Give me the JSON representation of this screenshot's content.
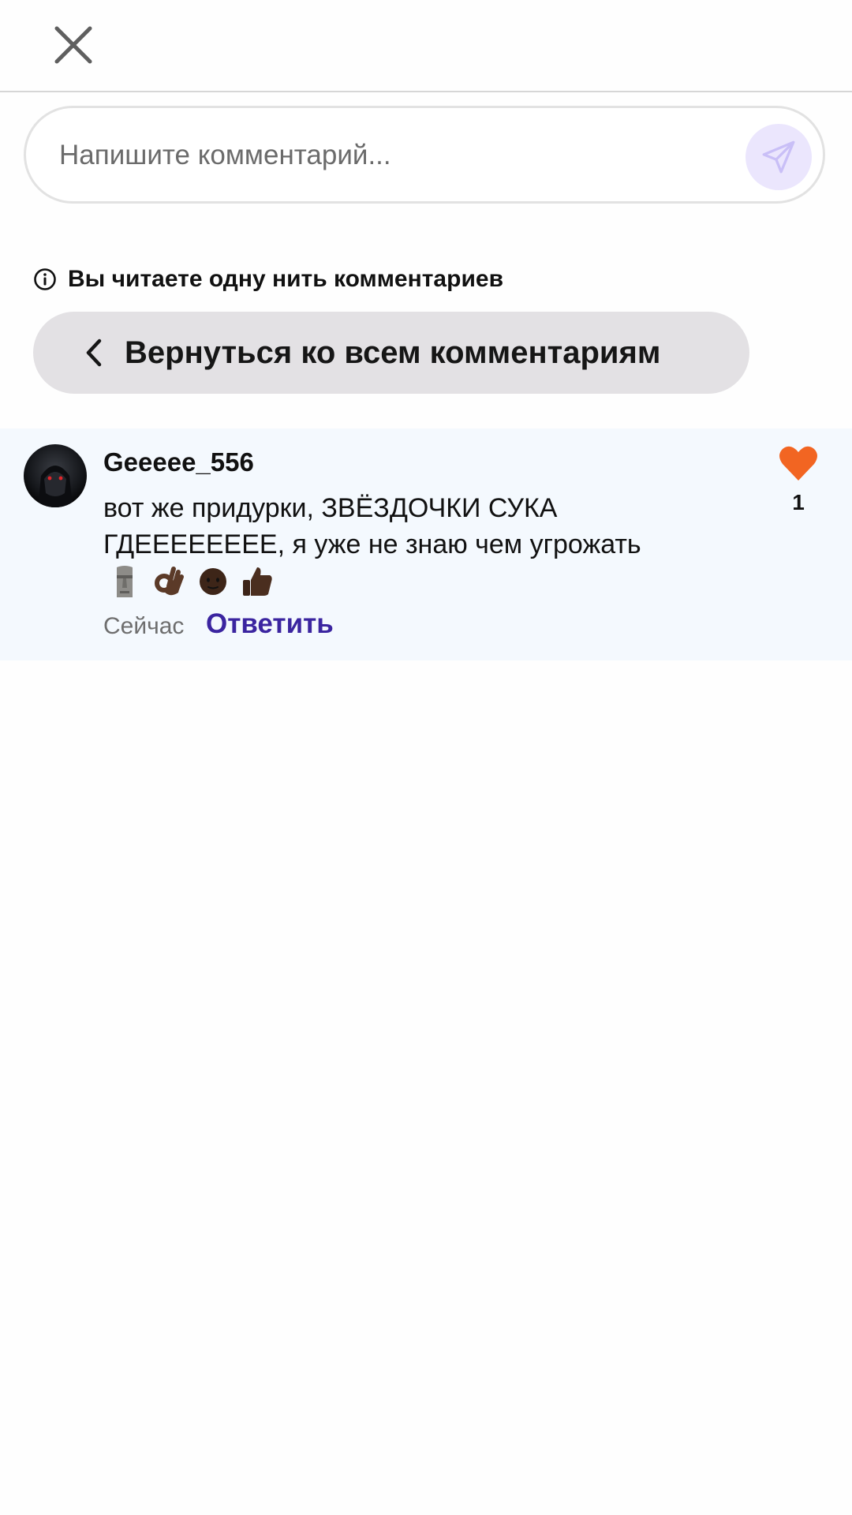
{
  "header": {
    "close_icon": "close-icon"
  },
  "composer": {
    "placeholder": "Напишите комментарий...",
    "value": "",
    "send_icon": "send-icon",
    "send_bg_color": "#ebe6fd"
  },
  "thread": {
    "notice": "Вы читаете одну нить комментариев",
    "notice_icon": "info-icon",
    "back_label": "Вернуться ко всем комментариям",
    "back_icon": "chevron-left-icon"
  },
  "comment": {
    "author": "Geeeee_556",
    "text": "вот же придурки, ЗВЁЗДОЧКИ СУКА ГДЕЕЕЕЕЕЕЕ, я уже не знаю чем угрожать",
    "emojis": [
      "moai-emoji",
      "ok-hand-emoji",
      "face-emoji",
      "thumbs-up-emoji"
    ],
    "time": "Сейчас",
    "reply_label": "Ответить",
    "like_count": "1",
    "like_icon": "heart-icon",
    "like_color": "#f26522",
    "reply_color": "#3b25a0",
    "background_color": "#f4f9fe"
  }
}
